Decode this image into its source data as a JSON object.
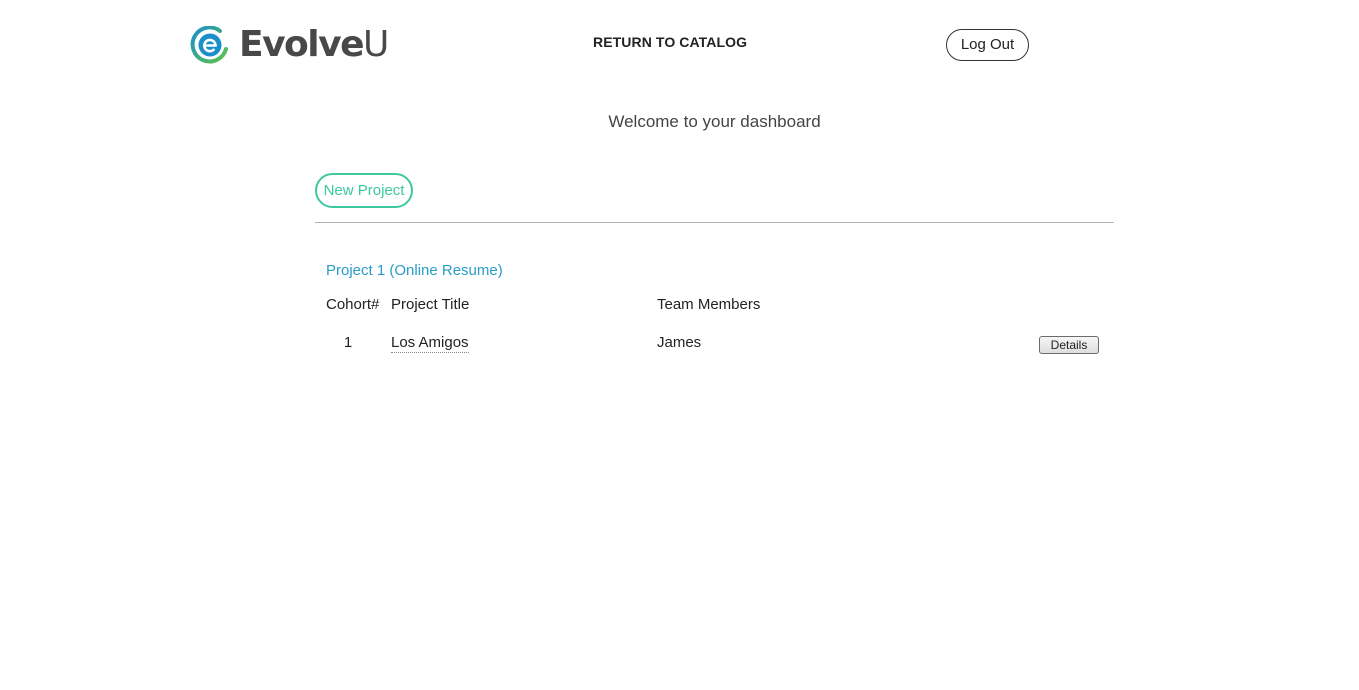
{
  "brand": {
    "name_bold": "Evolve",
    "name_light": "U",
    "logo_icon": "evolveu-e-icon",
    "colors": {
      "blue": "#1a8fc9",
      "green": "#5fc24a"
    }
  },
  "header": {
    "return_label": "RETURN TO CATALOG",
    "logout_label": "Log Out"
  },
  "main": {
    "welcome": "Welcome to your dashboard",
    "new_project_label": "New Project",
    "accent_color": "#3cc9a0",
    "section_title": "Project 1 (Online Resume)",
    "section_title_color": "#2a9cc8",
    "columns": [
      "Cohort#",
      "Project Title",
      "Team Members"
    ],
    "rows": [
      {
        "cohort": "1",
        "title": "Los Amigos",
        "members": "James",
        "details_label": "Details"
      }
    ]
  }
}
